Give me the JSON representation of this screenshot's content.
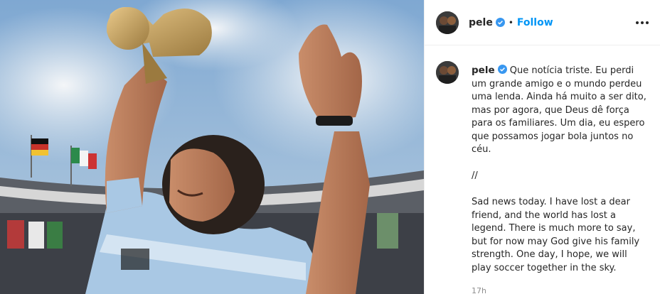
{
  "post": {
    "username": "pele",
    "follow_label": "Follow",
    "separator": "•",
    "caption_pt": "Que notícia triste. Eu perdi um grande amigo e o mundo perdeu uma lenda. Ainda há muito a ser dito, mas por agora, que Deus dê força para os familiares. Um dia, eu espero que possamos jogar bola juntos no céu.",
    "caption_divider": "//",
    "caption_en": "Sad news today. I have lost a dear friend, and the world has lost a legend. There is much more to say, but for now may God give his family strength. One day, I hope, we will play soccer together in the sky.",
    "timestamp": "17h"
  },
  "colors": {
    "accent": "#0095f6",
    "text": "#262626",
    "muted": "#8e8e8e",
    "border": "#efefef"
  },
  "icons": {
    "verified": "verified-badge-icon",
    "more": "more-options-icon"
  }
}
